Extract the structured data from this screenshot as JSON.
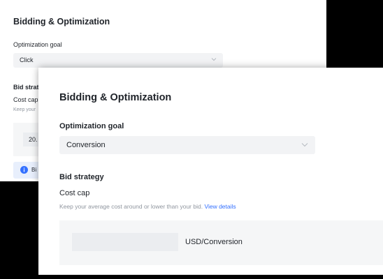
{
  "back_panel": {
    "title": "Bidding & Optimization",
    "optimization_goal_label": "Optimization goal",
    "optimization_goal_value": "Click",
    "bid_strategy_label": "Bid strate",
    "cost_cap_label": "Cost cap",
    "cost_cap_hint": "Keep your",
    "bid_value": "20.",
    "info_text": "Bi"
  },
  "front_panel": {
    "title": "Bidding & Optimization",
    "optimization_goal_label": "Optimization goal",
    "optimization_goal_value": "Conversion",
    "bid_strategy_label": "Bid strategy",
    "cost_cap_label": "Cost cap",
    "cost_cap_hint": "Keep your average cost around or lower than your bid. ",
    "view_details_link": "View details",
    "bid_input_value": "",
    "bid_unit": "USD/Conversion"
  },
  "icons": {
    "chevron": "chevron-down-icon",
    "info": "info-icon"
  },
  "colors": {
    "link": "#3370ff",
    "info_icon": "#3370ff",
    "info_background": "#e8effc",
    "field_background": "#f2f3f5",
    "hint_text": "#8f959e"
  }
}
